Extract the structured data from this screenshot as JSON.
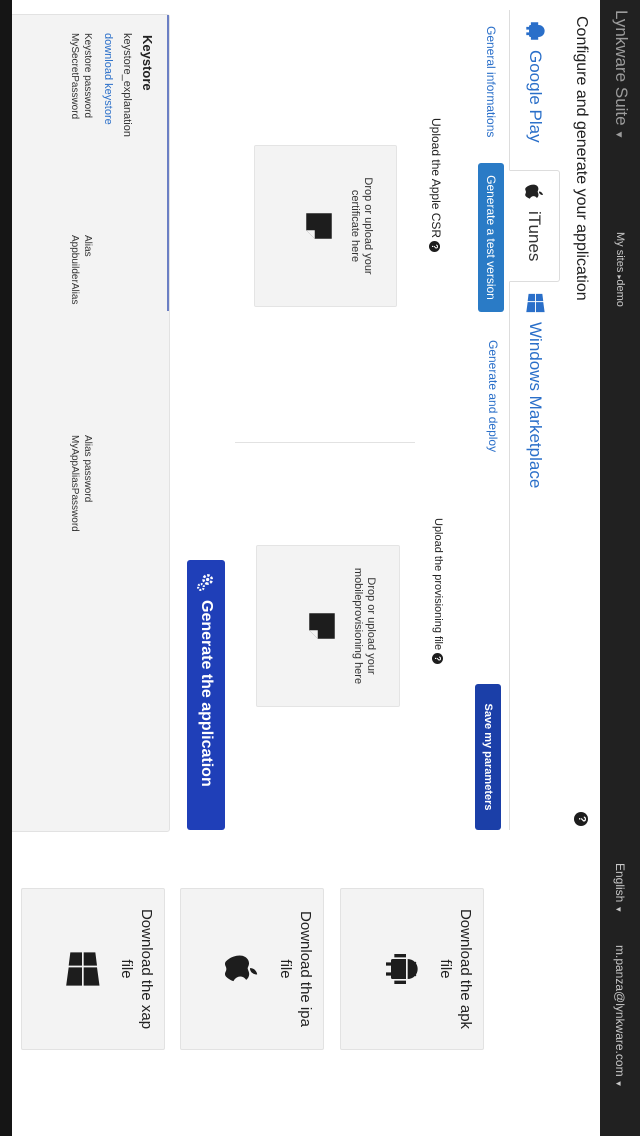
{
  "navbar": {
    "brand": "Lynkware Suite",
    "sites": "My sites",
    "sites_current": "demo",
    "language": "English",
    "user": "m.panza@lynkware.com"
  },
  "page": {
    "title": "Configure and generate your application"
  },
  "tabs": [
    {
      "label": "Google Play",
      "icon": "android-icon"
    },
    {
      "label": "iTunes",
      "icon": "apple-icon"
    },
    {
      "label": "Windows Marketplace",
      "icon": "windows-icon"
    }
  ],
  "subnav": {
    "general": "General informations",
    "test_button": "Generate a test version",
    "deploy": "Generate and deploy",
    "save_button": "Save my parameters"
  },
  "upload": {
    "csr_label": "Upload the Apple CSR",
    "csr_drop": "Drop or upload your certificate here",
    "provisioning_label": "Upload the provisioning file",
    "provisioning_drop": "Drop or upload your mobileprovisioning here"
  },
  "generate_button": "Generate the application",
  "keystore": {
    "title": "Keystore",
    "explanation": "keystore_explanation",
    "download_link": "download keystore",
    "keystore_password_label": "Keystore password",
    "keystore_password_value": "MySecretPassword",
    "alias_label": "Alias",
    "alias_value": "AppbuilderAlias",
    "alias_password_label": "Alias password",
    "alias_password_value": "MyAppAliasPassword"
  },
  "downloads": [
    {
      "label": "Download the apk file",
      "icon": "android-icon"
    },
    {
      "label": "Download the ipa file",
      "icon": "apple-icon"
    },
    {
      "label": "Download the xap file",
      "icon": "windows-icon"
    }
  ],
  "colors": {
    "navbar": "#212121",
    "link": "#2a6fc9",
    "primary_button": "#2a7bc6",
    "dark_button": "#1f3fb8"
  }
}
